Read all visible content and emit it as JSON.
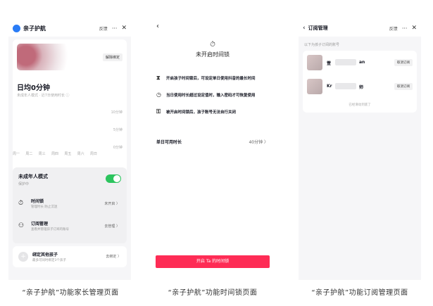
{
  "panel1": {
    "title": "亲子护航",
    "feedback": "反馈",
    "more": "···",
    "close": "✕",
    "unbind": "解除绑定",
    "daily_time": "日均0分钟",
    "daily_sub": "未成年人模式 · 近7日使用时长 ⓘ",
    "y_ticks": [
      "10分钟",
      "5分钟",
      "0分钟"
    ],
    "days": [
      "周一",
      "周二",
      "周三",
      "周四",
      "周五",
      "周六",
      "周日"
    ],
    "mode_title": "未成年人模式",
    "mode_sub": "保护中",
    "mode_on": true,
    "rows": [
      {
        "icon": "⏱",
        "title": "时间锁",
        "sub": "管理时长 防止沉迷",
        "value": "未开启 〉"
      },
      {
        "icon": "⚇",
        "title": "订阅管理",
        "sub": "查看并管理孩子订阅的账号",
        "value": "去管理 〉"
      }
    ],
    "bind_title": "绑定其他孩子",
    "bind_sub": "最多可同时绑定3个孩子",
    "bind_value": "去绑定 〉"
  },
  "panel2": {
    "back": "‹",
    "lock_title": "未开启时间锁",
    "lines": [
      {
        "icon": "⧗",
        "text": "开启孩子时间锁后，可设定单日使用抖音的最长时间"
      },
      {
        "icon": "◷",
        "text": "当日使用时长超过设定值时，输入密码才可恢复使用"
      },
      {
        "icon": "⚿",
        "text": "被开启时间锁后，孩子账号无法自行关闭"
      }
    ],
    "avail_label": "单日可用时长",
    "avail_value": "40分钟 〉",
    "cta": "开启 Ta 的时间锁"
  },
  "panel3": {
    "back": "‹",
    "title": "订阅管理",
    "feedback": "反馈",
    "more": "···",
    "close": "✕",
    "hint": "以下为孩子订阅的账号",
    "accounts": [
      {
        "name_start": "萱",
        "name_end": "an",
        "cancel": "取消订阅"
      },
      {
        "name_start": "Kr",
        "name_end": "师",
        "cancel": "取消订阅"
      }
    ],
    "end": "已经滑动到底了"
  },
  "captions": [
    "“亲子护航”功能家长管理页面",
    "“亲子护航”功能时间锁页面",
    "“亲子护航”功能订阅管理页面"
  ]
}
